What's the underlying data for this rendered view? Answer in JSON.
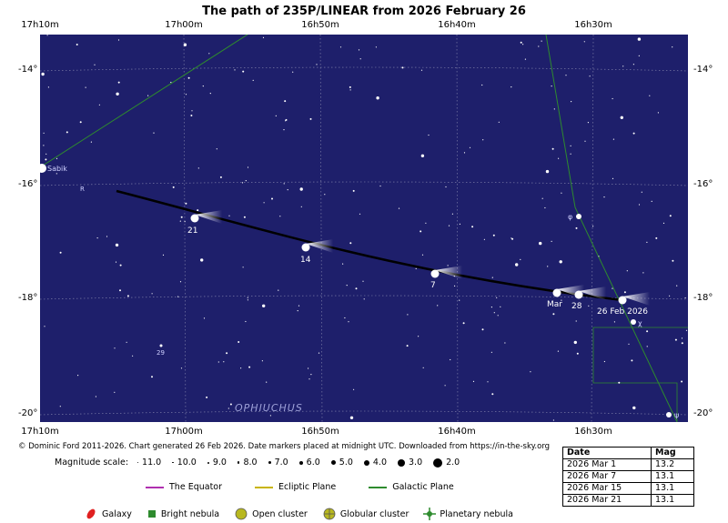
{
  "title": "The path of 235P/LINEAR from 2026 February 26",
  "ra_labels": [
    "17h10m",
    "17h00m",
    "16h50m",
    "16h40m",
    "16h30m"
  ],
  "dec_labels": [
    "-14°",
    "-16°",
    "-18°",
    "-20°"
  ],
  "constellation": "OPHIUCHUS",
  "star_labels": {
    "sabik": "Sabik",
    "r": "R",
    "phi": "φ",
    "chi": "χ",
    "psi": "ψ",
    "n29": "29"
  },
  "path_markers": [
    {
      "label": "21"
    },
    {
      "label": "14"
    },
    {
      "label": "7"
    },
    {
      "label": "Mar"
    },
    {
      "label": "28"
    },
    {
      "label": "26 Feb 2026"
    }
  ],
  "credit": "© Dominic Ford 2011-2026. Chart generated 26 Feb 2026. Date markers placed at midnight UTC. Downloaded from https://in-the-sky.org",
  "mag_scale_label": "Magnitude scale:",
  "mag_scale": [
    "11.0",
    "10.0",
    "9.0",
    "8.0",
    "7.0",
    "6.0",
    "5.0",
    "4.0",
    "3.0",
    "2.0"
  ],
  "legend_lines": [
    {
      "label": "The Equator",
      "color": "#b030b0"
    },
    {
      "label": "Ecliptic Plane",
      "color": "#c8b400"
    },
    {
      "label": "Galactic Plane",
      "color": "#2e8b2e"
    }
  ],
  "legend_objects": [
    {
      "label": "Galaxy",
      "icon": "galaxy-icon"
    },
    {
      "label": "Bright nebula",
      "icon": "bright-nebula-icon"
    },
    {
      "label": "Open cluster",
      "icon": "open-cluster-icon"
    },
    {
      "label": "Globular cluster",
      "icon": "globular-cluster-icon"
    },
    {
      "label": "Planetary nebula",
      "icon": "planetary-nebula-icon"
    }
  ],
  "ephemeris": {
    "headers": [
      "Date",
      "Mag"
    ],
    "rows": [
      [
        "2026 Mar 1",
        "13.2"
      ],
      [
        "2026 Mar 7",
        "13.1"
      ],
      [
        "2026 Mar 15",
        "13.1"
      ],
      [
        "2026 Mar 21",
        "13.1"
      ]
    ]
  },
  "colors": {
    "sky": "#1e1f6b",
    "grid": "#8a8bb0",
    "path": "#000000",
    "galactic": "#2e8b2e"
  }
}
